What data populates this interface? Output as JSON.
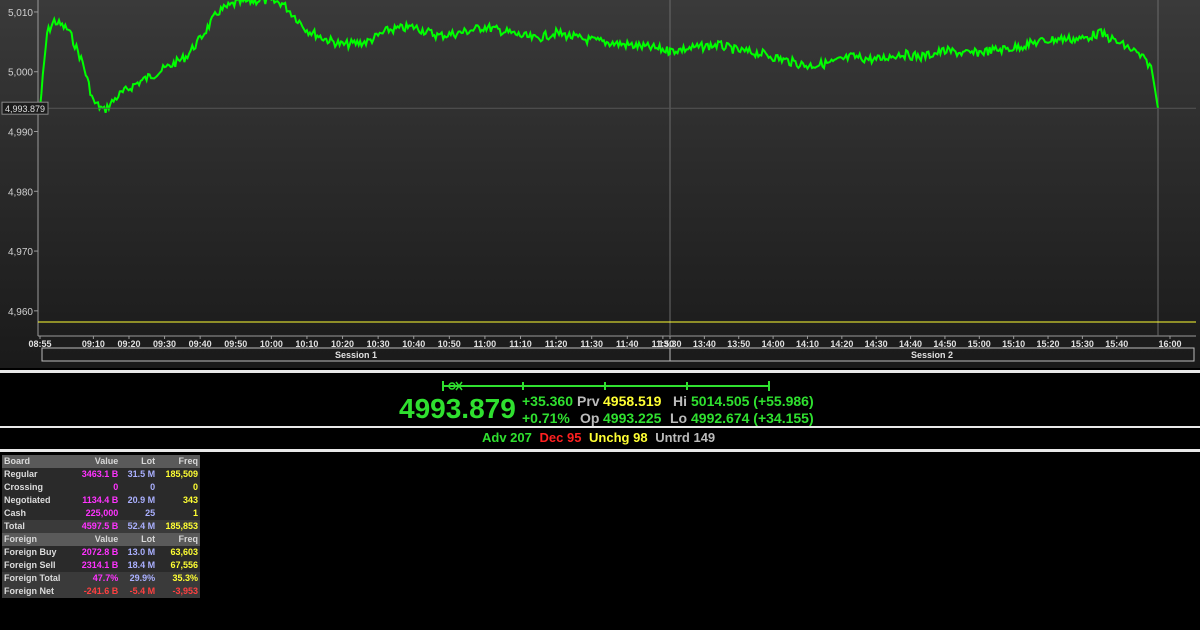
{
  "chart_data": {
    "type": "line",
    "y_ticks": [
      "5,010",
      "5,000",
      "4,990",
      "4,980",
      "4,970",
      "4,960"
    ],
    "x_ticks": [
      "08:55",
      "09:10",
      "09:20",
      "09:30",
      "09:40",
      "09:50",
      "10:00",
      "10:10",
      "10:20",
      "10:30",
      "10:40",
      "10:50",
      "11:00",
      "11:10",
      "11:20",
      "11:30",
      "11:40",
      "11:50",
      "13:30",
      "13:40",
      "13:50",
      "14:00",
      "14:10",
      "14:20",
      "14:30",
      "14:40",
      "14:50",
      "15:00",
      "15:10",
      "15:20",
      "15:30",
      "15:40",
      "16:00"
    ],
    "sessions": [
      "Session 1",
      "Session 2"
    ],
    "last_value_label": "4,993.879",
    "ylim": [
      4958.3,
      5012.0
    ],
    "series": [
      {
        "points": [
          [
            "08:55",
            4993.9
          ],
          [
            "08:57",
            5006.5
          ],
          [
            "08:59",
            5008.5
          ],
          [
            "09:03",
            5007.0
          ],
          [
            "09:07",
            5001.5
          ],
          [
            "09:10",
            4995.0
          ],
          [
            "09:13",
            4993.5
          ],
          [
            "09:17",
            4996.0
          ],
          [
            "09:22",
            4998.0
          ],
          [
            "09:30",
            5000.5
          ],
          [
            "09:36",
            5002.5
          ],
          [
            "09:40",
            5005.5
          ],
          [
            "09:45",
            5010.0
          ],
          [
            "09:50",
            5011.5
          ],
          [
            "09:57",
            5012.0
          ],
          [
            "10:03",
            5011.5
          ],
          [
            "10:07",
            5009.0
          ],
          [
            "10:10",
            5007.0
          ],
          [
            "10:15",
            5005.5
          ],
          [
            "10:20",
            5004.5
          ],
          [
            "10:27",
            5005.0
          ],
          [
            "10:33",
            5007.0
          ],
          [
            "10:40",
            5007.5
          ],
          [
            "10:47",
            5006.0
          ],
          [
            "10:53",
            5006.5
          ],
          [
            "11:00",
            5007.5
          ],
          [
            "11:07",
            5006.5
          ],
          [
            "11:14",
            5005.5
          ],
          [
            "11:20",
            5006.5
          ],
          [
            "11:27",
            5005.5
          ],
          [
            "11:33",
            5005.0
          ],
          [
            "11:40",
            5004.5
          ],
          [
            "11:47",
            5004.0
          ],
          [
            "11:52",
            5003.5
          ],
          [
            "13:30",
            5003.5
          ],
          [
            "13:37",
            5004.0
          ],
          [
            "13:44",
            5004.5
          ],
          [
            "13:50",
            5003.5
          ],
          [
            "13:57",
            5003.0
          ],
          [
            "14:03",
            5002.0
          ],
          [
            "14:10",
            5001.0
          ],
          [
            "14:17",
            5001.5
          ],
          [
            "14:23",
            5002.5
          ],
          [
            "14:30",
            5002.0
          ],
          [
            "14:37",
            5003.0
          ],
          [
            "14:43",
            5002.5
          ],
          [
            "14:50",
            5003.5
          ],
          [
            "14:57",
            5003.0
          ],
          [
            "15:03",
            5003.5
          ],
          [
            "15:10",
            5004.0
          ],
          [
            "15:17",
            5005.0
          ],
          [
            "15:23",
            5005.5
          ],
          [
            "15:30",
            5005.5
          ],
          [
            "15:35",
            5006.5
          ],
          [
            "15:40",
            5005.0
          ],
          [
            "15:45",
            5003.5
          ],
          [
            "15:50",
            5001.0
          ],
          [
            "15:52",
            4993.9
          ]
        ]
      }
    ]
  },
  "quote": {
    "last": "4993.879",
    "chg": "+35.360",
    "pct": "+0.71%",
    "prv_label": "Prv",
    "prv": "4958.519",
    "op_label": "Op",
    "op": "4993.225",
    "hi_label": "Hi",
    "hi": "5014.505 (+55.986)",
    "lo_label": "Lo",
    "lo": "4992.674 (+34.155)"
  },
  "breadth": {
    "adv": "Adv 207",
    "dec": "Dec 95",
    "unchg": "Unchg 98",
    "untrd": "Untrd 149"
  },
  "board": {
    "headers": [
      "Board",
      "Value",
      "Lot",
      "Freq"
    ],
    "rows": [
      [
        "Regular",
        "3463.1 B",
        "31.5 M",
        "185,509"
      ],
      [
        "Crossing",
        "0",
        "0",
        "0"
      ],
      [
        "Negotiated",
        "1134.4 B",
        "20.9 M",
        "343"
      ],
      [
        "Cash",
        "225,000",
        "25",
        "1"
      ],
      [
        "Total",
        "4597.5 B",
        "52.4 M",
        "185,853"
      ]
    ]
  },
  "foreign": {
    "headers": [
      "Foreign",
      "Value",
      "Lot",
      "Freq"
    ],
    "rows": [
      [
        "Foreign Buy",
        "2072.8 B",
        "13.0 M",
        "63,603"
      ],
      [
        "Foreign Sell",
        "2314.1 B",
        "18.4 M",
        "67,556"
      ],
      [
        "Foreign Total",
        "47.7%",
        "29.9%",
        "35.3%"
      ],
      [
        "Foreign Net",
        "-241.6 B",
        "-5.4 M",
        "-3,953"
      ]
    ]
  },
  "colors": {
    "line": "#00ff00",
    "up": "#2fe02f",
    "down": "#ff2020",
    "flat": "#ffff33"
  }
}
